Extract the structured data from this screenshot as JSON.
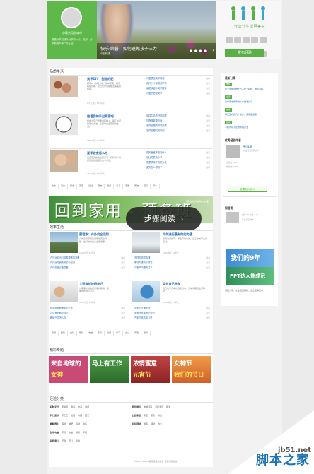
{
  "hero": {
    "user_name": "心境共用创城市",
    "quote": "最受分享如快乐分享的一天，说好，分享着城市每一件生活",
    "slide_title": "快乐·荣誉：如何避免孩子压力",
    "slide_sub": "今日精选",
    "slogan": "分享让生活更美好",
    "publish_label": "发布经验"
  },
  "sections": {
    "life": "品质生活",
    "efficient": "效率生活",
    "topics": "精彩专题",
    "categories": "经验分类"
  },
  "life_features": [
    {
      "title": "美甲DIY｜甜甜的配",
      "desc": "美甲DIY教程分享，简单漂亮，颜色搭配好看，自己在家也能做出美美的指甲。",
      "meta": "1.2万浏览  345评论",
      "list": [
        "可爱镜面美甲教程",
        "我们小小家庭美甲师",
        "最受欢迎小美甲推荐",
        "可爱的甜甜美甲"
      ],
      "list_r": [
        "推荐",
        "最新",
        "热门",
        "推荐"
      ]
    },
    {
      "title": "抱着我的手过家家吧",
      "desc": "想成为自己想要的那种人，除了时间管理好方法，还要学会合理安排生活。",
      "meta": "9862浏览  216评论",
      "list": [
        "最佳生活的好时间表",
        "熬夜族健康必备",
        "怎样合理安排时间表",
        "怎样合理利用时间"
      ],
      "list_r": [
        "推荐",
        "最新",
        "热门",
        "推荐"
      ]
    },
    {
      "title": "夏季饮食怎么办",
      "desc": "宝宝夏天饮食注意事项，妈妈们一定要知道的健康饮食小常识。",
      "meta": "7511浏览  188评论",
      "list": [
        "夏天宝宝不能吃什么",
        "最让打发天小子",
        "夜里哄孩子的好办法",
        "夏天怎么带孩子"
      ],
      "list_r": [
        "推荐",
        "最新",
        "热门",
        "推荐"
      ]
    }
  ],
  "life_tags": [
    "饮食",
    "美食",
    "旅游",
    "美容",
    "运动",
    "宠物",
    "健康",
    "亲子",
    "家居",
    "购物",
    "宝贝",
    "汽车"
  ],
  "banner": {
    "big": "回到家用 - 预备班",
    "small": "更多生活经验分享"
  },
  "step_read": "步骤阅读",
  "efficient_features": [
    {
      "title": "露营族：户外安全须知",
      "desc": "户外露营需要注意哪些安全问题，出行前准备齐全很重要。",
      "meta": "6204浏览  97评论",
      "list": [
        "户外运动出行前需要做的准备",
        "户外运动受伤的的小知识",
        "户外露营必备装备"
      ],
      "list_r": [
        "推荐",
        "最新",
        "热门"
      ]
    },
    {
      "title": "如何进行最有效的沟通",
      "desc": "职场沟通技巧，学会有效沟通，让工作效率大大提升。",
      "meta": "5310浏览  76评论",
      "list": [
        "怎样与领导沟通",
        "职场沟通的小技巧",
        "与客户沟通的艺术"
      ],
      "list_r": [
        "推荐",
        "最新",
        "热门"
      ]
    },
    {
      "title": "上班族的护眼技巧",
      "desc": "长期面对电脑如何保护眼睛，简单的护眼小方法。",
      "meta": "4988浏览  63评论",
      "list": [
        "预防电脑眼疲劳的方法",
        "办公室护眼小技巧",
        "眼睛干涩怎么办"
      ],
      "list_r": [
        "推荐",
        "最新",
        "热门"
      ]
    },
    {
      "title": "如何自己洗车",
      "desc": "自己动手洗车省钱又省心，洗车步骤和注意事项。",
      "meta": "3876浏览  52评论",
      "list": [
        "洗车的正确步骤",
        "夏季汽车保养小知识",
        "汽车内饰清洁方法"
      ],
      "list_r": [
        "推荐",
        "最新",
        "热门"
      ]
    }
  ],
  "efficient_tags": [
    "职场",
    "数码",
    "出行",
    "理财",
    "电脑",
    "手机",
    "交通",
    "学习",
    "办公",
    "网购",
    "软件"
  ],
  "topics": [
    {
      "line1": "来自地球的",
      "line2": "女神",
      "color": "#d84b74"
    },
    {
      "line1": "马上有工作",
      "line2": "",
      "color": "#3b8a3b"
    },
    {
      "line1": "浓情蜜意",
      "line2": "元宵节",
      "color": "#b43a3a"
    },
    {
      "line1": "女神节",
      "line2": "我们的节日",
      "color": "#e2793a"
    }
  ],
  "categories": [
    [
      "美食/烹饪",
      "家常菜",
      "甜品",
      "饮品",
      "烘焙",
      "早餐"
    ],
    [
      "手工/爱好",
      "手工艺",
      "绘画",
      "收藏",
      "园艺"
    ],
    [
      "健康/养生",
      "保健",
      "减肥",
      "运动",
      "中医"
    ],
    [
      "数码/电脑",
      "手机",
      "电脑",
      "相机",
      "平板"
    ],
    [
      "母婴/育儿",
      "怀孕",
      "育儿",
      "早教"
    ],
    [
      "游戏/娱乐",
      "电脑游戏",
      "手机游戏",
      "网游"
    ],
    [
      "生活/家居",
      "家居",
      "装修",
      "清洁"
    ],
    [
      "职场/理财",
      "求职",
      "理财",
      "办公"
    ]
  ],
  "side": {
    "hot_title": "最新分享",
    "hot_items": [
      {
        "badge": "推荐",
        "text": "夏天这些食物千万不能一起吃，你知道吗"
      },
      {
        "badge": "生活",
        "text": "简单易学的家常小炒做法分享"
      },
      {
        "badge": "健康",
        "text": "每天坚持这几个动作，身体更健康"
      },
      {
        "badge": "数码",
        "text": "手机内存不足的清理方法"
      }
    ],
    "rec_title": "优秀经验作者",
    "rec_name": "明日生活",
    "rec_list": [
      "认证生活经验达人",
      "经验数 128",
      "粉丝数 3265"
    ],
    "join_label": "我要加入达人",
    "profile_name": "知道哥",
    "profile_meta": "经验 32  粉丝 120",
    "profile_sub": "专业手工制作",
    "ad1": "我们的9年",
    "ad2": "PPT达人炼成记",
    "side_note": "经验分享，让生活更美好，点击查看更多"
  },
  "footer": "©2014 Baidu  使用百度前必读  百度经验协议",
  "watermark": {
    "site": "jb51.net",
    "cn": "脚本之家"
  },
  "colors": {
    "green": "#59b044",
    "link": "#2a6fb7"
  }
}
